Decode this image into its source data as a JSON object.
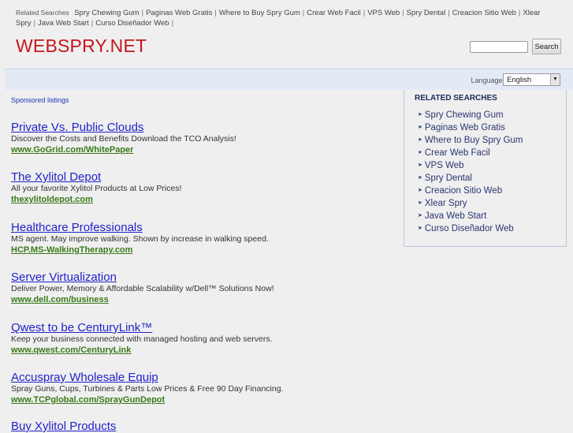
{
  "top": {
    "label": "Related Searches",
    "links": [
      "Spry Chewing Gum",
      "Paginas Web Gratis",
      "Where to Buy Spry Gum",
      "Crear Web Facil",
      "VPS Web",
      "Spry Dental",
      "Creacion Sitio Web",
      "Xlear Spry",
      "Java Web Start",
      "Curso Diseñador Web"
    ]
  },
  "logo": "WEBSPRY.NET",
  "search": {
    "value": "",
    "button": "Search"
  },
  "language": {
    "label": "Language:",
    "selected": "English"
  },
  "sponsored": "Sponsored listings",
  "ads": [
    {
      "title": "Private Vs. Public Clouds",
      "desc": "Discover the Costs and Benefits Download the TCO Analysis!",
      "url": "www.GoGrid.com/WhitePaper"
    },
    {
      "title": "The Xylitol Depot",
      "desc": "All your favorite Xylitol Products at Low Prices!",
      "url": "thexylitoldepot.com"
    },
    {
      "title": "Healthcare Professionals",
      "desc": "MS agent. May improve walking. Shown by increase in walking speed.",
      "url": "HCP.MS-WalkingTherapy.com"
    },
    {
      "title": "Server Virtualization",
      "desc": "Deliver Power, Memory & Affordable Scalability w/Dell™ Solutions Now!",
      "url": "www.dell.com/business"
    },
    {
      "title": "Qwest to be CenturyLink™",
      "desc": "Keep your business connected with managed hosting and web servers.",
      "url": "www.qwest.com/CenturyLink"
    },
    {
      "title": "Accuspray Wholesale Equip",
      "desc": "Spray Guns, Cups, Turbines & Parts Low Prices & Free 90 Day Financing.",
      "url": "www.TCPglobal.com/SprayGunDepot"
    },
    {
      "title": "Buy Xylitol Products"
    }
  ],
  "sidebar": {
    "title": "RELATED SEARCHES",
    "items": [
      "Spry Chewing Gum",
      "Paginas Web Gratis",
      "Where to Buy Spry Gum",
      "Crear Web Facil",
      "VPS Web",
      "Spry Dental",
      "Creacion Sitio Web",
      "Xlear Spry",
      "Java Web Start",
      "Curso Diseñador Web"
    ]
  }
}
